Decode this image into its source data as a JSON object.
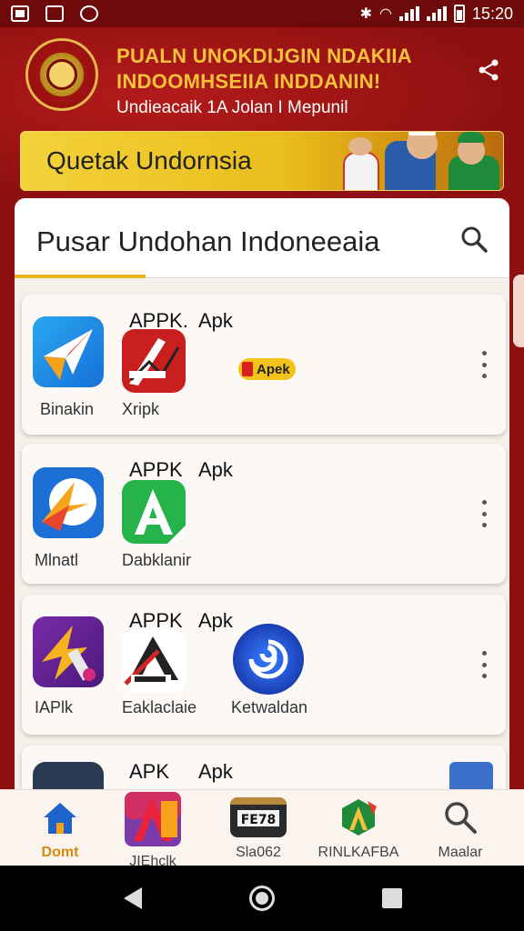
{
  "status_bar": {
    "time": "15:20"
  },
  "header": {
    "title": "PUALN UNOKDIJGIN NDAKIIA INDOOMHSEIIA INDDANIN!",
    "subtitle": "Undieacaik 1A Jolan I Mepunil",
    "share_icon": "share-icon",
    "banner_text": "Quetak Undornsia"
  },
  "main": {
    "search_title": "Pusar Undohan Indoneeaia",
    "search_icon": "search-icon"
  },
  "apps": [
    {
      "label_left": "APPK.",
      "label_right": "Apk",
      "items": [
        {
          "name": "Binakin",
          "icon": "paper-plane-icon"
        },
        {
          "name": "Xripk",
          "icon": "pen-tool-icon"
        }
      ],
      "badge": "Apek"
    },
    {
      "label_left": "APPK",
      "label_right": "Apk",
      "items": [
        {
          "name": "Mlnatl",
          "icon": "star-play-icon"
        },
        {
          "name": "Dabklanir",
          "icon": "green-a-icon"
        }
      ]
    },
    {
      "label_left": "APPK",
      "label_right": "Apk",
      "items": [
        {
          "name": "IAPlk",
          "icon": "purple-star-icon"
        },
        {
          "name": "Eaklaclaie",
          "icon": "red-a-icon"
        },
        {
          "name": "Ketwaldan",
          "icon": "blue-swirl-icon"
        }
      ]
    },
    {
      "label_left": "APK",
      "label_right": "Apk",
      "items": []
    }
  ],
  "bottom_nav": [
    {
      "label": "Domt",
      "icon": "home-icon",
      "active": true
    },
    {
      "label": "JIEhclk",
      "icon": "red-a-app-icon",
      "active": false
    },
    {
      "label": "Sla062",
      "icon": "film-icon",
      "active": false
    },
    {
      "label": "RINLKAFBA",
      "icon": "green-a-app-icon",
      "active": false
    },
    {
      "label": "Maalar",
      "icon": "search-icon",
      "active": false
    }
  ],
  "colors": {
    "brand_red": "#8e1010",
    "accent_gold": "#f6c23a",
    "active_nav": "#d48a0c"
  }
}
